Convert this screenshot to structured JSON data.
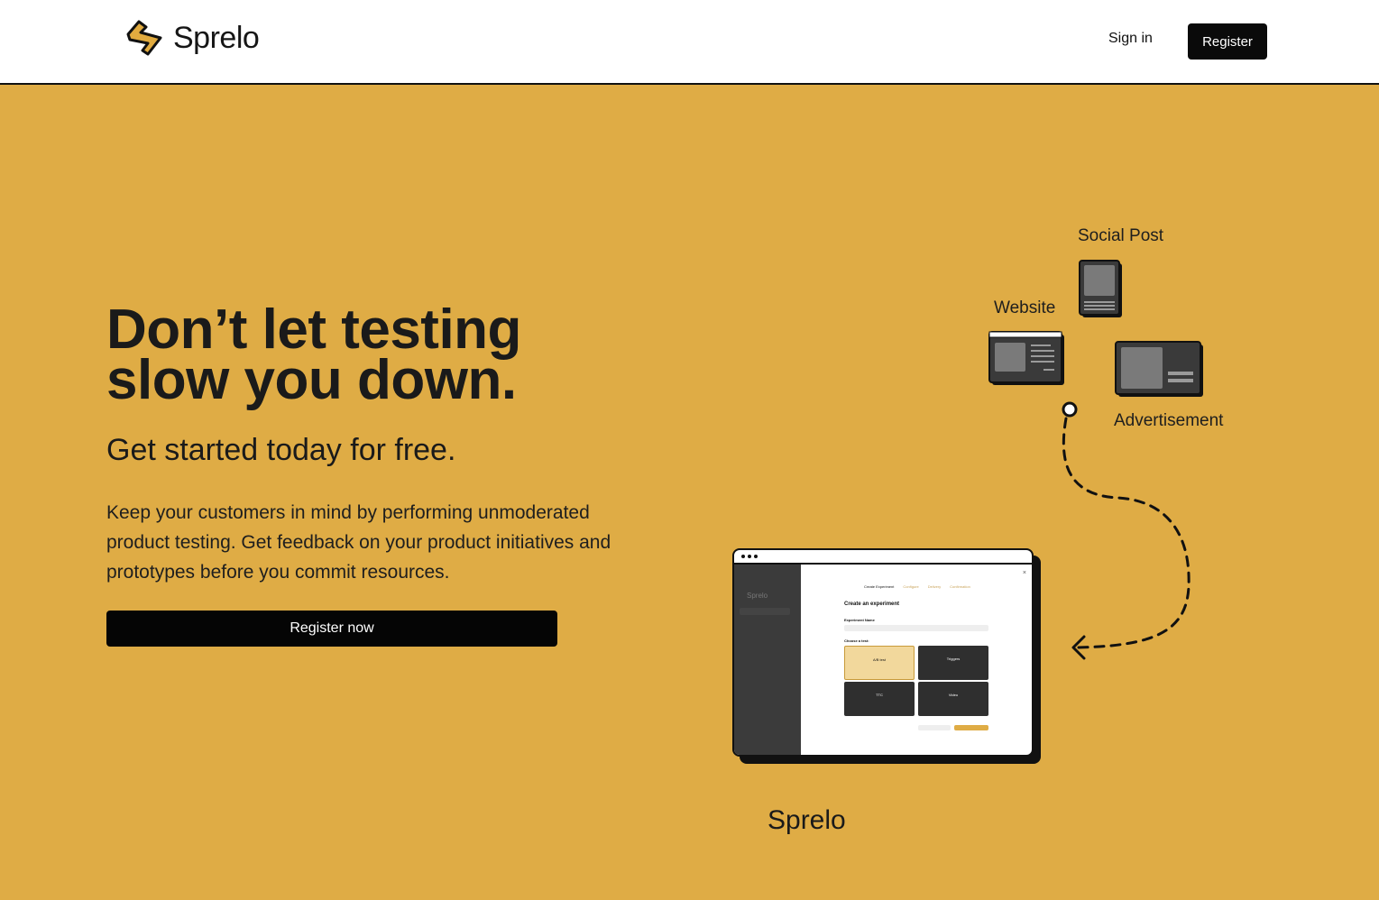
{
  "header": {
    "brand": "Sprelo",
    "sign_in_label": "Sign in",
    "register_label": "Register"
  },
  "hero": {
    "title_line1": "Don’t let testing",
    "title_line2": "slow you down.",
    "subtitle": "Get started today for free.",
    "body": "Keep your customers in mind by performing unmoderated product testing. Get feedback on your product initiatives and prototypes before you commit resources.",
    "cta_label": "Register now"
  },
  "illustration": {
    "labels": {
      "social_post": "Social Post",
      "website": "Website",
      "advertisement": "Advertisement",
      "app": "Sprelo"
    },
    "mock": {
      "brand": "Sprelo",
      "steps": [
        "Create Experiment",
        "Configure",
        "Delivery",
        "Confirmation"
      ],
      "heading": "Create an experiment",
      "name_label": "Experiment Name",
      "choose_label": "Choose a test:",
      "tests": [
        "A/B test",
        "Triggers",
        "TTC",
        "Video"
      ]
    }
  },
  "colors": {
    "accent": "#dfac45",
    "dark": "#0a0a0a",
    "white": "#ffffff"
  }
}
